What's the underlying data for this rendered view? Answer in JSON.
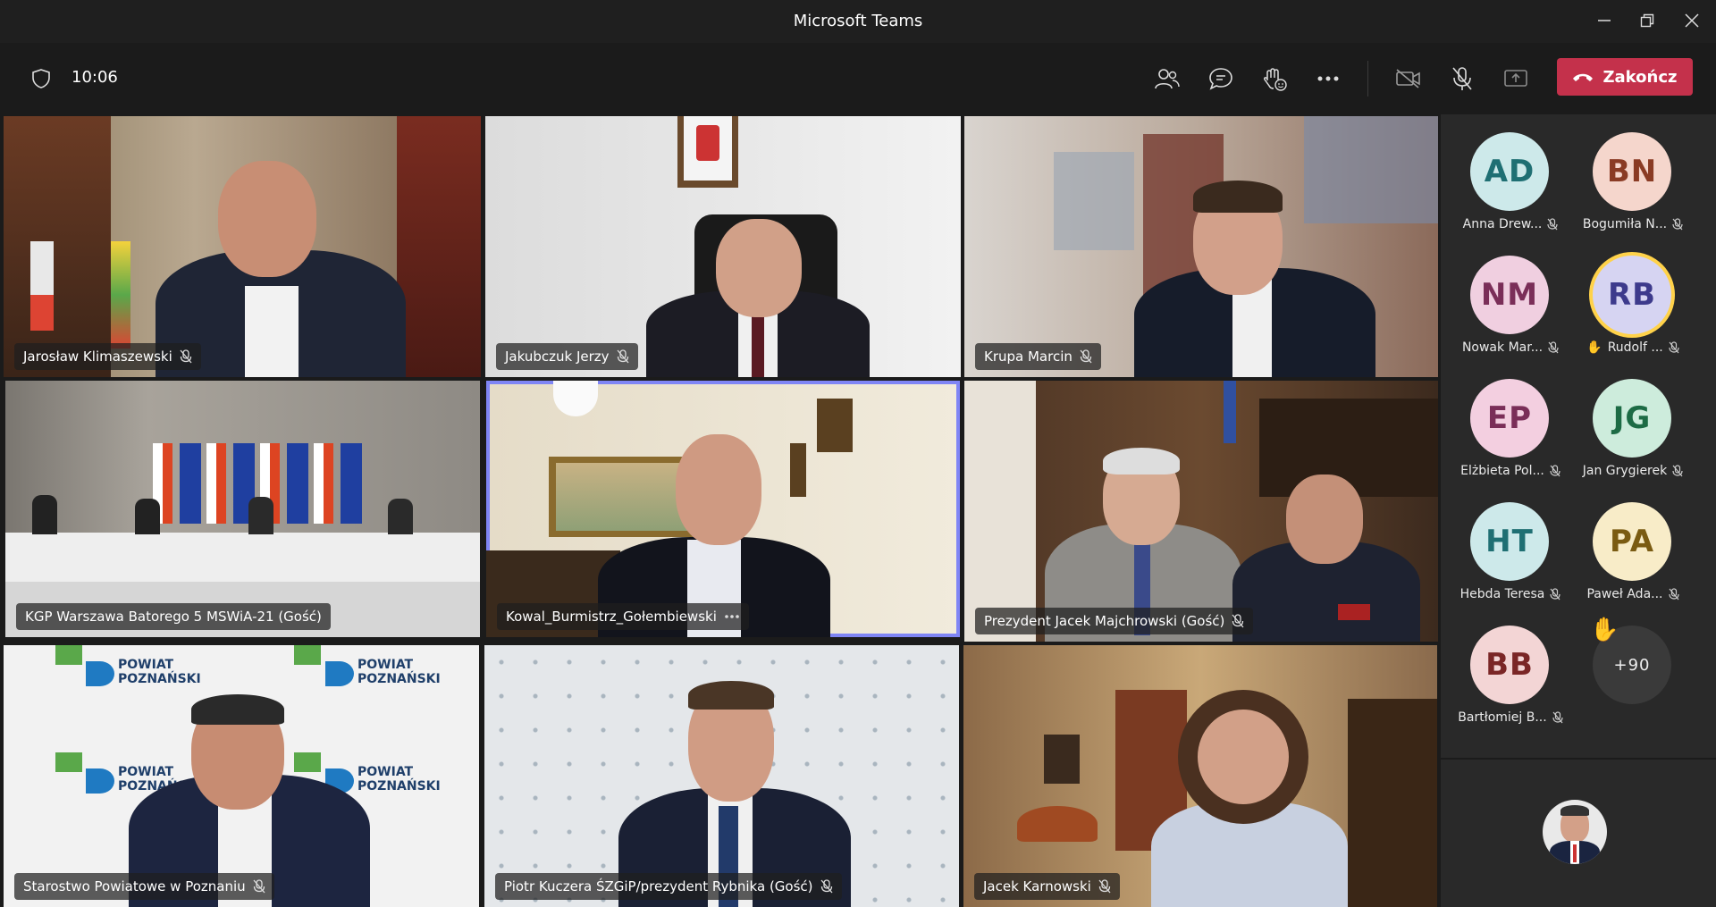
{
  "window": {
    "title": "Microsoft Teams"
  },
  "toolbar": {
    "time": "10:06",
    "end_call_label": "Zakończ"
  },
  "tiles": [
    {
      "name": "Jarosław Klimaszewski",
      "muted": true,
      "active": false,
      "scene": "office-flags"
    },
    {
      "name": "Jakubczuk Jerzy",
      "muted": true,
      "active": false,
      "scene": "white-room"
    },
    {
      "name": "Krupa Marcin",
      "muted": true,
      "active": false,
      "scene": "blurred-room"
    },
    {
      "name": "KGP Warszawa Batorego 5 MSWiA-21 (Gość)",
      "muted": false,
      "active": true,
      "scene": "conference"
    },
    {
      "name": "Kowal_Burmistrz_Gołembiewski",
      "muted": false,
      "more": true,
      "active": true,
      "scene": "office-painting"
    },
    {
      "name": "Prezydent Jacek Majchrowski (Gość)",
      "muted": true,
      "active": false,
      "scene": "wood-office"
    },
    {
      "name": "Starostwo Powiatowe w Poznaniu",
      "muted": true,
      "active": false,
      "scene": "powiat-wall"
    },
    {
      "name": "Piotr Kuczera ŚZGiP/prezydent Rybnika (Gość)",
      "muted": true,
      "active": false,
      "scene": "logo-wall"
    },
    {
      "name": "Jacek Karnowski",
      "muted": true,
      "active": false,
      "scene": "library"
    }
  ],
  "roster": [
    {
      "initials": "AD",
      "name": "Anna Drew...",
      "bg": "#cde9ea",
      "fg": "#1f6f73",
      "muted": true
    },
    {
      "initials": "BN",
      "name": "Bogumiła N...",
      "bg": "#f5d6cc",
      "fg": "#8a3b24",
      "muted": true
    },
    {
      "initials": "NM",
      "name": "Nowak Mar...",
      "bg": "#f0cfe0",
      "fg": "#7a2e58",
      "muted": true
    },
    {
      "initials": "RB",
      "name": "Rudolf ...",
      "bg": "#d6d4f2",
      "fg": "#3d3a8c",
      "muted": true,
      "hand": true,
      "highlight": true
    },
    {
      "initials": "EP",
      "name": "Elżbieta Pol...",
      "bg": "#f3cfe0",
      "fg": "#7a2e58",
      "muted": true
    },
    {
      "initials": "JG",
      "name": "Jan Grygierek",
      "bg": "#cdecdc",
      "fg": "#1d6b45",
      "muted": true
    },
    {
      "initials": "HT",
      "name": "Hebda Teresa",
      "bg": "#cde9ea",
      "fg": "#1f6f73",
      "muted": true
    },
    {
      "initials": "PA",
      "name": "Paweł Ada...",
      "bg": "#f8ecc8",
      "fg": "#7a5b12",
      "muted": true
    },
    {
      "initials": "BB",
      "name": "Bartłomiej B...",
      "bg": "#f3d5d5",
      "fg": "#7a2626",
      "muted": true
    }
  ],
  "overflow": {
    "label": "+90"
  },
  "colors": {
    "accent": "#7f85f5",
    "end_call": "#c4314b",
    "hand": "#f6c344"
  }
}
